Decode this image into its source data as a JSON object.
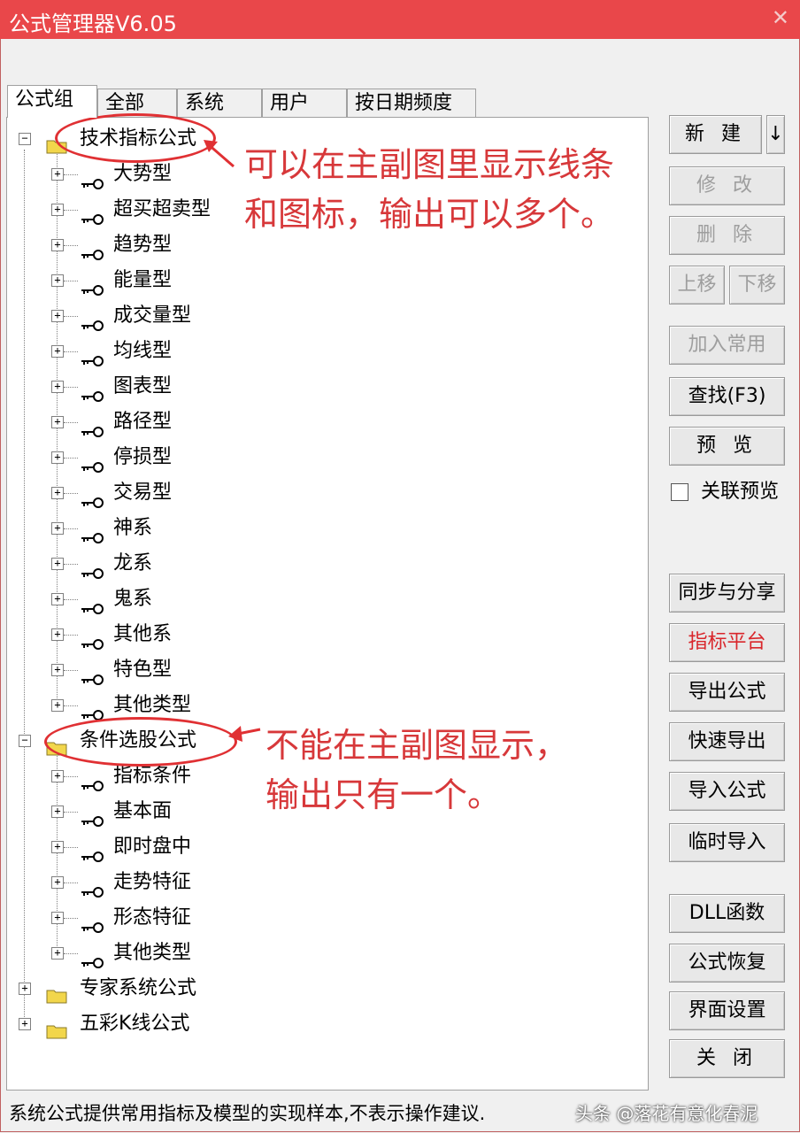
{
  "window": {
    "title": "公式管理器V6.05",
    "close_glyph": "✕"
  },
  "tabs": [
    "公式组",
    "全部",
    "系统",
    "用户",
    "按日期频度"
  ],
  "tree": {
    "group1": {
      "label": "技术指标公式",
      "items": [
        "大势型",
        "超买超卖型",
        "趋势型",
        "能量型",
        "成交量型",
        "均线型",
        "图表型",
        "路径型",
        "停损型",
        "交易型",
        "神系",
        "龙系",
        "鬼系",
        "其他系",
        "特色型",
        "其他类型"
      ]
    },
    "group2": {
      "label": "条件选股公式",
      "items": [
        "指标条件",
        "基本面",
        "即时盘中",
        "走势特征",
        "形态特征",
        "其他类型"
      ]
    },
    "group3": {
      "label": "专家系统公式"
    },
    "group4": {
      "label": "五彩K线公式"
    }
  },
  "annotations": {
    "note1_line1": "可以在主副图里显示线条",
    "note1_line2": "和图标，输出可以多个。",
    "note2_line1": "不能在主副图显示，",
    "note2_line2": "输出只有一个。"
  },
  "buttons": {
    "new": "新 建",
    "new_arrow": "↓",
    "edit": "修 改",
    "delete": "删 除",
    "move_up": "上移",
    "move_down": "下移",
    "add_common": "加入常用",
    "find": "查找(F3)",
    "preview": "预 览",
    "linked_preview": "关联预览",
    "sync_share": "同步与分享",
    "indicator_platform": "指标平台",
    "export": "导出公式",
    "quick_export": "快速导出",
    "import": "导入公式",
    "temp_import": "临时导入",
    "dll": "DLL函数",
    "restore": "公式恢复",
    "ui_settings": "界面设置",
    "close": "关 闭"
  },
  "status": {
    "text": "系统公式提供常用指标及模型的实现样本,不表示操作建议.",
    "watermark": "头条 @落花有意化春泥"
  },
  "colors": {
    "titlebar": "#e9474a",
    "annotation": "#d7383a",
    "folder": "#f2d64b"
  }
}
